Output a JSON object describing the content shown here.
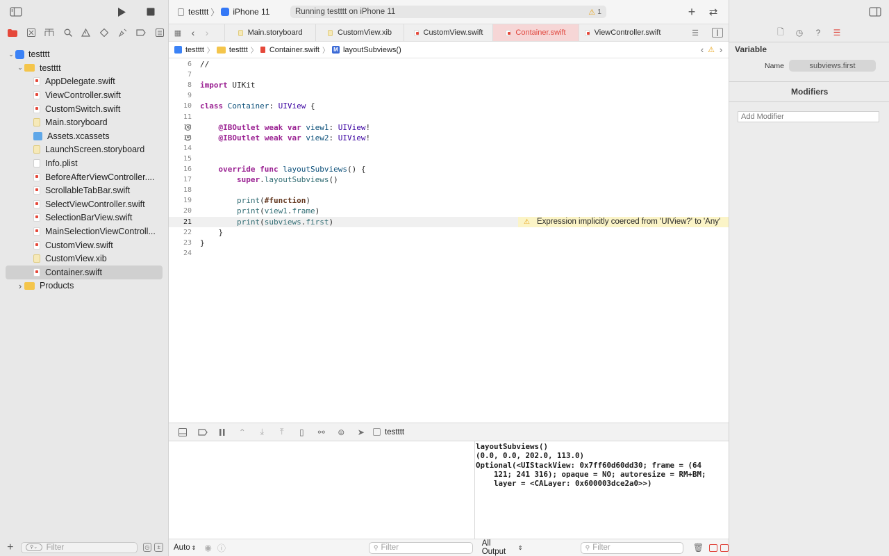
{
  "toolbar": {
    "scheme_project": "testttt",
    "scheme_device": "iPhone 11",
    "activity_text": "Running testttt on iPhone 11",
    "warning_count": "1"
  },
  "navigator": {
    "items": [
      {
        "label": "testttt",
        "kind": "project",
        "depth": 0,
        "expanded": true
      },
      {
        "label": "testttt",
        "kind": "folder",
        "depth": 1,
        "expanded": true
      },
      {
        "label": "AppDelegate.swift",
        "kind": "swift",
        "depth": 2
      },
      {
        "label": "ViewController.swift",
        "kind": "swift",
        "depth": 2
      },
      {
        "label": "CustomSwitch.swift",
        "kind": "swift",
        "depth": 2
      },
      {
        "label": "Main.storyboard",
        "kind": "sb",
        "depth": 2
      },
      {
        "label": "Assets.xcassets",
        "kind": "assets",
        "depth": 2
      },
      {
        "label": "LaunchScreen.storyboard",
        "kind": "sb",
        "depth": 2
      },
      {
        "label": "Info.plist",
        "kind": "plist",
        "depth": 2
      },
      {
        "label": "BeforeAfterViewController....",
        "kind": "swift",
        "depth": 2
      },
      {
        "label": "ScrollableTabBar.swift",
        "kind": "swift",
        "depth": 2
      },
      {
        "label": "SelectViewController.swift",
        "kind": "swift",
        "depth": 2
      },
      {
        "label": "SelectionBarView.swift",
        "kind": "swift",
        "depth": 2
      },
      {
        "label": "MainSelectionViewControll...",
        "kind": "swift",
        "depth": 2
      },
      {
        "label": "CustomView.swift",
        "kind": "swift",
        "depth": 2
      },
      {
        "label": "CustomView.xib",
        "kind": "sb",
        "depth": 2
      },
      {
        "label": "Container.swift",
        "kind": "swift",
        "depth": 2,
        "selected": true
      },
      {
        "label": "Products",
        "kind": "folder",
        "depth": 1,
        "expanded": false
      }
    ],
    "filter_placeholder": "Filter"
  },
  "tabs": [
    {
      "label": "Main.storyboard",
      "kind": "sb"
    },
    {
      "label": "CustomView.xib",
      "kind": "sb"
    },
    {
      "label": "CustomView.swift",
      "kind": "swift"
    },
    {
      "label": "Container.swift",
      "kind": "swift",
      "active": true
    },
    {
      "label": "ViewController.swift",
      "kind": "swift"
    }
  ],
  "jumpbar": {
    "project": "testttt",
    "folder": "testttt",
    "file": "Container.swift",
    "symbol_badge": "M",
    "symbol": "layoutSubviews()"
  },
  "editor": {
    "current_line": 21,
    "lines": [
      {
        "n": 6,
        "tokens": [
          [
            "plain",
            "//"
          ]
        ]
      },
      {
        "n": 7,
        "tokens": []
      },
      {
        "n": 8,
        "tokens": [
          [
            "kw",
            "import"
          ],
          [
            "plain",
            " UIKit"
          ]
        ]
      },
      {
        "n": 9,
        "tokens": []
      },
      {
        "n": 10,
        "tokens": [
          [
            "kw",
            "class"
          ],
          [
            "plain",
            " "
          ],
          [
            "tyc",
            "Container"
          ],
          [
            "plain",
            ": "
          ],
          [
            "ty",
            "UIView"
          ],
          [
            "plain",
            " {"
          ]
        ]
      },
      {
        "n": 11,
        "tokens": []
      },
      {
        "n": 12,
        "breakpoint": true,
        "tokens": [
          [
            "plain",
            "    "
          ],
          [
            "kw",
            "@IBOutlet"
          ],
          [
            "plain",
            " "
          ],
          [
            "kw",
            "weak"
          ],
          [
            "plain",
            " "
          ],
          [
            "kw",
            "var"
          ],
          [
            "plain",
            " "
          ],
          [
            "tyc",
            "view1"
          ],
          [
            "plain",
            ": "
          ],
          [
            "ty",
            "UIView"
          ],
          [
            "plain",
            "!"
          ]
        ]
      },
      {
        "n": 13,
        "breakpoint": true,
        "tokens": [
          [
            "plain",
            "    "
          ],
          [
            "kw",
            "@IBOutlet"
          ],
          [
            "plain",
            " "
          ],
          [
            "kw",
            "weak"
          ],
          [
            "plain",
            " "
          ],
          [
            "kw",
            "var"
          ],
          [
            "plain",
            " "
          ],
          [
            "tyc",
            "view2"
          ],
          [
            "plain",
            ": "
          ],
          [
            "ty",
            "UIView"
          ],
          [
            "plain",
            "!"
          ]
        ]
      },
      {
        "n": 14,
        "tokens": []
      },
      {
        "n": 15,
        "tokens": []
      },
      {
        "n": 16,
        "tokens": [
          [
            "plain",
            "    "
          ],
          [
            "kw",
            "override"
          ],
          [
            "plain",
            " "
          ],
          [
            "kw",
            "func"
          ],
          [
            "plain",
            " "
          ],
          [
            "tyc",
            "layoutSubviews"
          ],
          [
            "plain",
            "() {"
          ]
        ]
      },
      {
        "n": 17,
        "tokens": [
          [
            "plain",
            "        "
          ],
          [
            "kw",
            "super"
          ],
          [
            "plain",
            "."
          ],
          [
            "fn",
            "layoutSubviews"
          ],
          [
            "plain",
            "()"
          ]
        ]
      },
      {
        "n": 18,
        "tokens": []
      },
      {
        "n": 19,
        "tokens": [
          [
            "plain",
            "        "
          ],
          [
            "fn",
            "print"
          ],
          [
            "plain",
            "("
          ],
          [
            "dir",
            "#function"
          ],
          [
            "plain",
            ")"
          ]
        ]
      },
      {
        "n": 20,
        "tokens": [
          [
            "plain",
            "        "
          ],
          [
            "fn",
            "print"
          ],
          [
            "plain",
            "("
          ],
          [
            "fn",
            "view1"
          ],
          [
            "plain",
            "."
          ],
          [
            "fn",
            "frame"
          ],
          [
            "plain",
            ")"
          ]
        ]
      },
      {
        "n": 21,
        "tokens": [
          [
            "plain",
            "        "
          ],
          [
            "fn",
            "print"
          ],
          [
            "plain",
            "("
          ],
          [
            "fn",
            "subviews"
          ],
          [
            "plain",
            "."
          ],
          [
            "fn",
            "first"
          ],
          [
            "plain",
            ")"
          ]
        ],
        "warning": "Expression implicitly coerced from 'UIView?' to 'Any'"
      },
      {
        "n": 22,
        "tokens": [
          [
            "plain",
            "    }"
          ]
        ]
      },
      {
        "n": 23,
        "tokens": [
          [
            "plain",
            "}"
          ]
        ]
      },
      {
        "n": 24,
        "tokens": []
      }
    ]
  },
  "debugbar": {
    "process_name": "testttt"
  },
  "console": {
    "output": "layoutSubviews()\n(0.0, 0.0, 202.0, 113.0)\nOptional(<UIStackView: 0x7ff60d60dd30; frame = (64\n    121; 241 316); opaque = NO; autoresize = RM+BM;\n    layer = <CALayer: 0x600003dce2a0>>)"
  },
  "debug_bottom": {
    "auto_label": "Auto",
    "variables_filter_placeholder": "Filter",
    "output_select": "All Output",
    "console_filter_placeholder": "Filter"
  },
  "inspector": {
    "variable_title": "Variable",
    "name_label": "Name",
    "name_value": "subviews.first",
    "modifiers_title": "Modifiers",
    "modifier_placeholder": "Add Modifier"
  }
}
